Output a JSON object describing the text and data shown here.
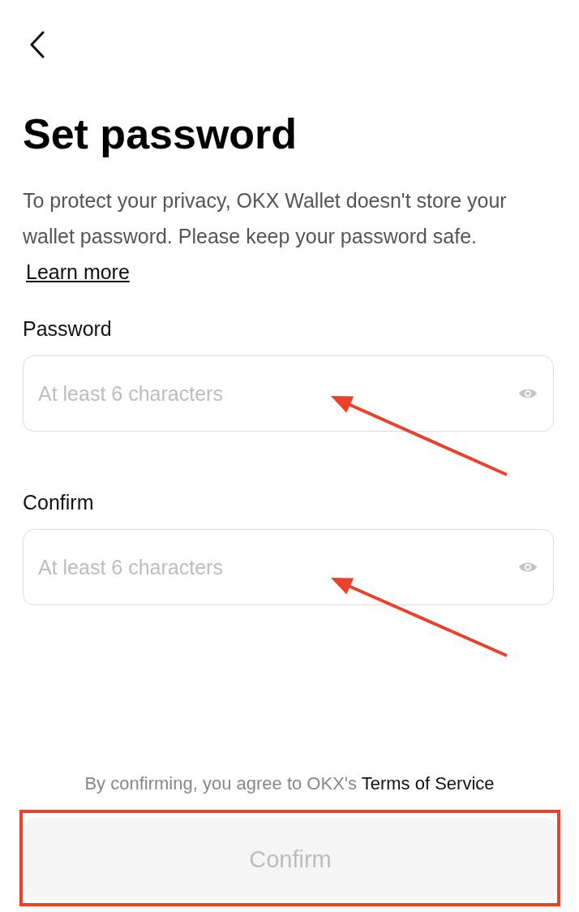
{
  "title": "Set password",
  "description": {
    "text": "To protect your privacy, OKX Wallet doesn't store your wallet password. Please keep your password safe.",
    "link": "Learn more"
  },
  "fields": [
    {
      "label": "Password",
      "placeholder": "At least 6 characters"
    },
    {
      "label": "Confirm",
      "placeholder": "At least 6 characters"
    }
  ],
  "terms": {
    "text": "By confirming, you agree to OKX's",
    "link": "Terms of Service"
  },
  "confirm_button": {
    "label": "Confirm",
    "disabled": true
  },
  "annotations": [
    {
      "kind": "arrow"
    },
    {
      "kind": "arrow"
    },
    {
      "kind": "frame"
    }
  ]
}
